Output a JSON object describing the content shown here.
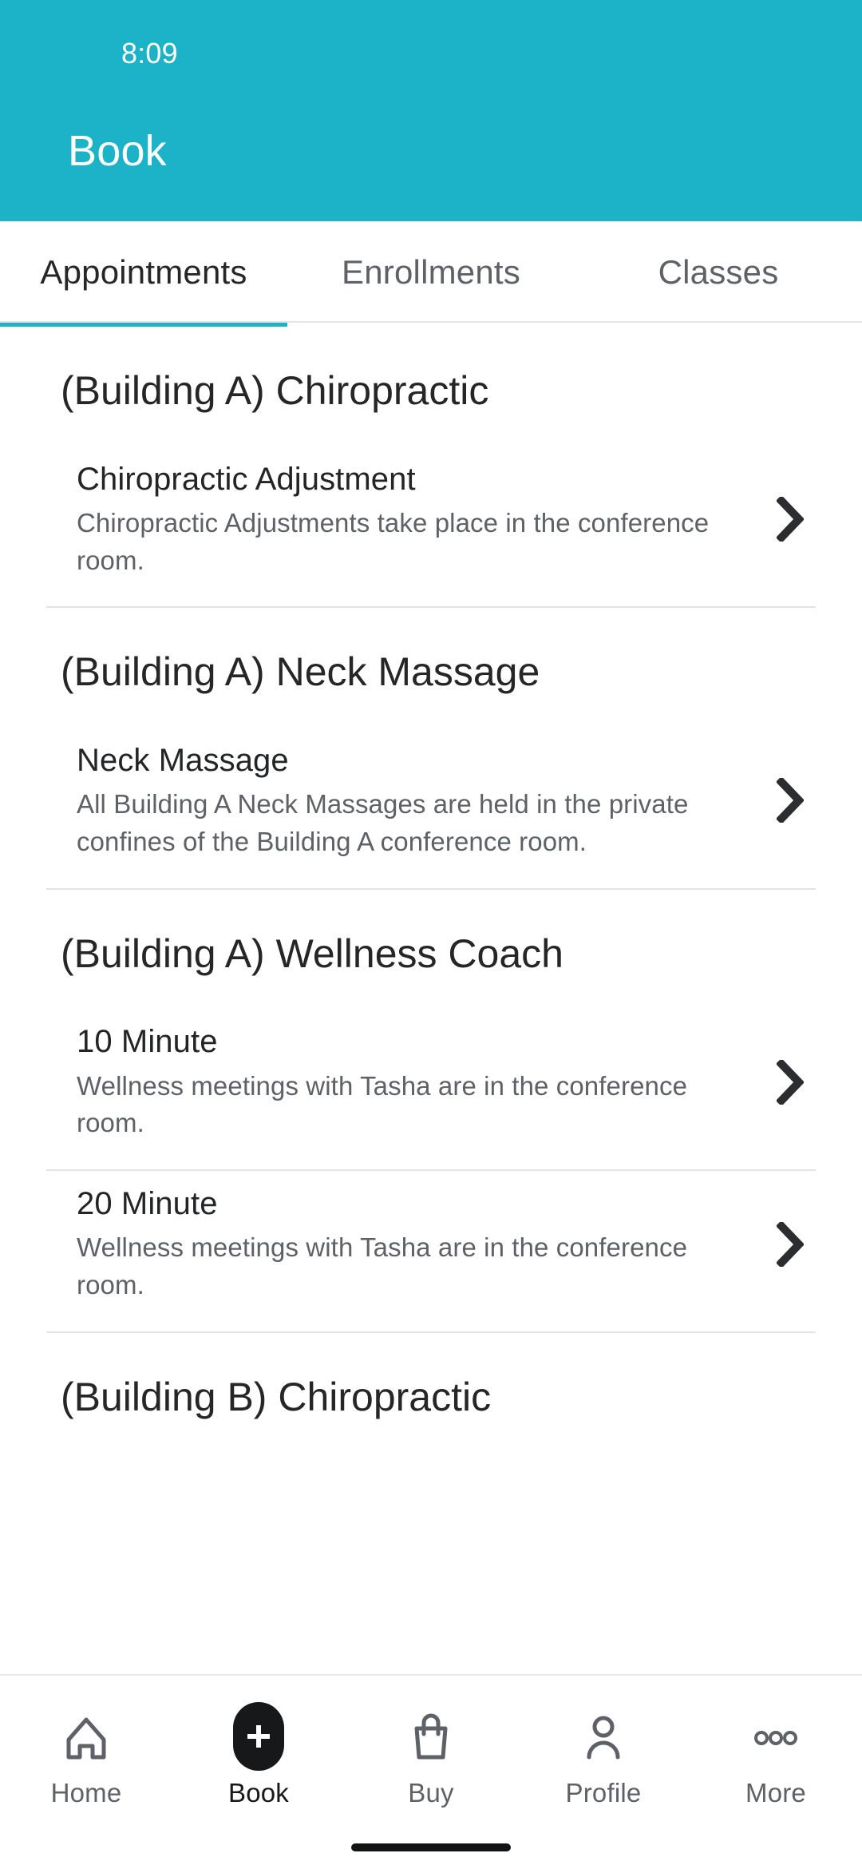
{
  "status_bar": {
    "time": "8:09"
  },
  "header": {
    "title": "Book",
    "bg_color": "#1CB2C8"
  },
  "tabs": {
    "active_index": 0,
    "items": [
      {
        "label": "Appointments"
      },
      {
        "label": "Enrollments"
      },
      {
        "label": "Classes"
      }
    ]
  },
  "content": {
    "sections": [
      {
        "header": "(Building A) Chiropractic",
        "items": [
          {
            "title": "Chiropractic Adjustment",
            "description": "Chiropractic Adjustments take place in the conference room.",
            "chevron": "chevron-right-icon"
          }
        ]
      },
      {
        "header": "(Building A) Neck Massage",
        "items": [
          {
            "title": "Neck Massage",
            "description": "All Building A Neck Massages are held in the private confines of the Building A conference room.",
            "chevron": "chevron-right-icon"
          }
        ]
      },
      {
        "header": "(Building A) Wellness Coach",
        "items": [
          {
            "title": "10 Minute",
            "description": "Wellness meetings with Tasha are in the conference room.",
            "chevron": "chevron-right-icon"
          },
          {
            "title": "20 Minute",
            "description": "Wellness meetings with Tasha are in the conference room.",
            "chevron": "chevron-right-icon"
          }
        ]
      },
      {
        "header": "(Building B) Chiropractic",
        "items": []
      }
    ]
  },
  "bottom_nav": {
    "active_index": 1,
    "items": [
      {
        "label": "Home",
        "icon": "home-icon"
      },
      {
        "label": "Book",
        "icon": "plus-icon"
      },
      {
        "label": "Buy",
        "icon": "shopping-bag-icon"
      },
      {
        "label": "Profile",
        "icon": "person-icon"
      },
      {
        "label": "More",
        "icon": "ellipsis-icon"
      }
    ]
  },
  "colors": {
    "accent": "#1CB2C8",
    "text_primary": "#262626",
    "text_secondary": "#5E6167",
    "divider": "#E2E3E5"
  }
}
